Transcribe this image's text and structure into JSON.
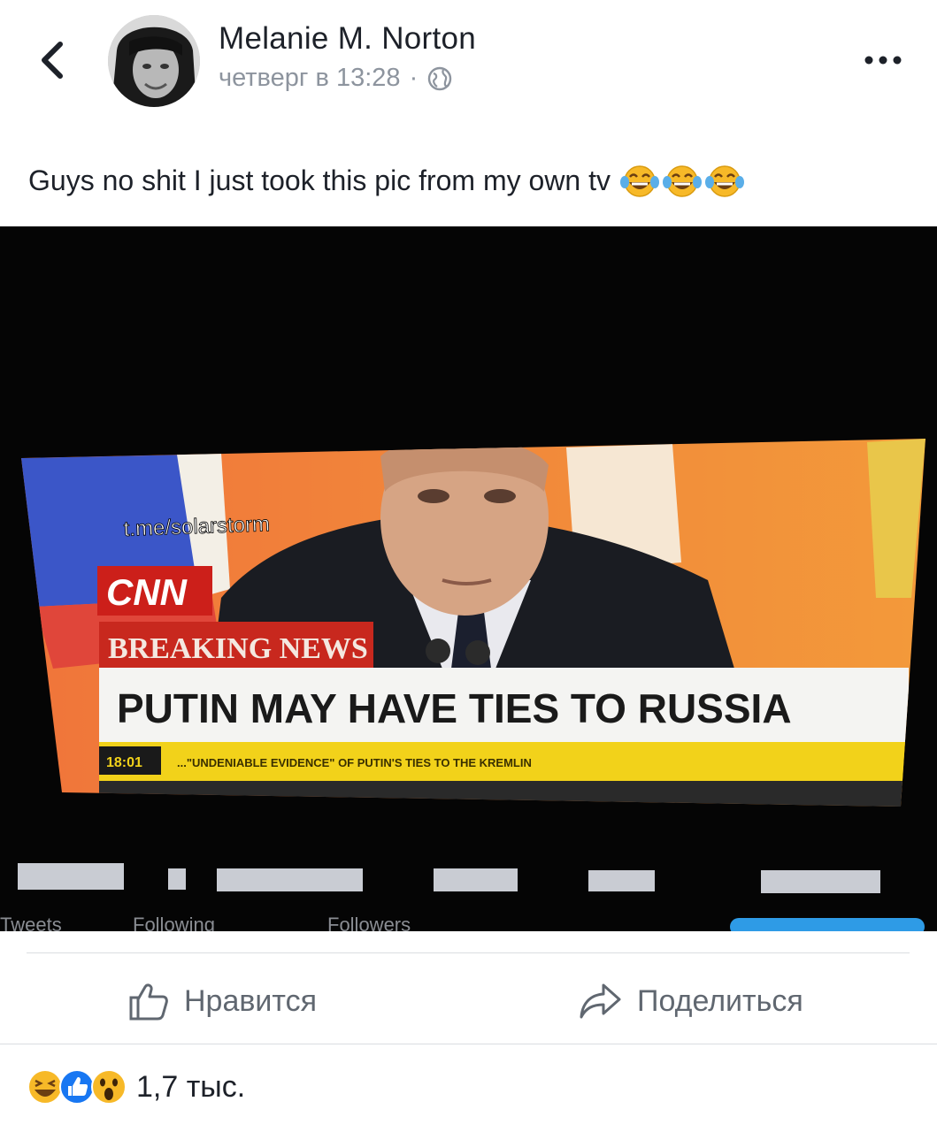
{
  "header": {
    "author_name": "Melanie M. Norton",
    "timestamp": "четверг в 13:28",
    "separator": "·",
    "privacy_icon": "globe-icon",
    "more_icon": "more-options-icon"
  },
  "post": {
    "text": "Guys no shit I just took this pic from my own tv",
    "emojis": [
      "tears-of-joy-emoji",
      "tears-of-joy-emoji",
      "tears-of-joy-emoji"
    ]
  },
  "photo": {
    "watermark": "t.me/solarstorm",
    "network_logo": "CNN",
    "breaking_label": "BREAKING NEWS",
    "headline": "PUTIN MAY HAVE TIES TO RUSSIA",
    "ticker_time": "18:01",
    "ticker_text": "...\"UNDENIABLE EVIDENCE\" OF PUTIN'S TIES TO THE KREMLIN",
    "tweets_label": "Tweets",
    "following_label": "Following",
    "followers_label": "Followers"
  },
  "actions": {
    "like_label": "Нравится",
    "share_label": "Поделиться"
  },
  "reactions": {
    "icons": [
      "laugh-reaction-icon",
      "like-reaction-icon",
      "wow-reaction-icon"
    ],
    "count": "1,7 тыс."
  },
  "colors": {
    "text": "#1d2129",
    "muted": "#8d949e",
    "action_gray": "#606770",
    "like_blue": "#1877f2",
    "emoji_yellow": "#f7b928",
    "breaking_red": "#c8281e",
    "ticker_yellow": "#f2d21a"
  }
}
